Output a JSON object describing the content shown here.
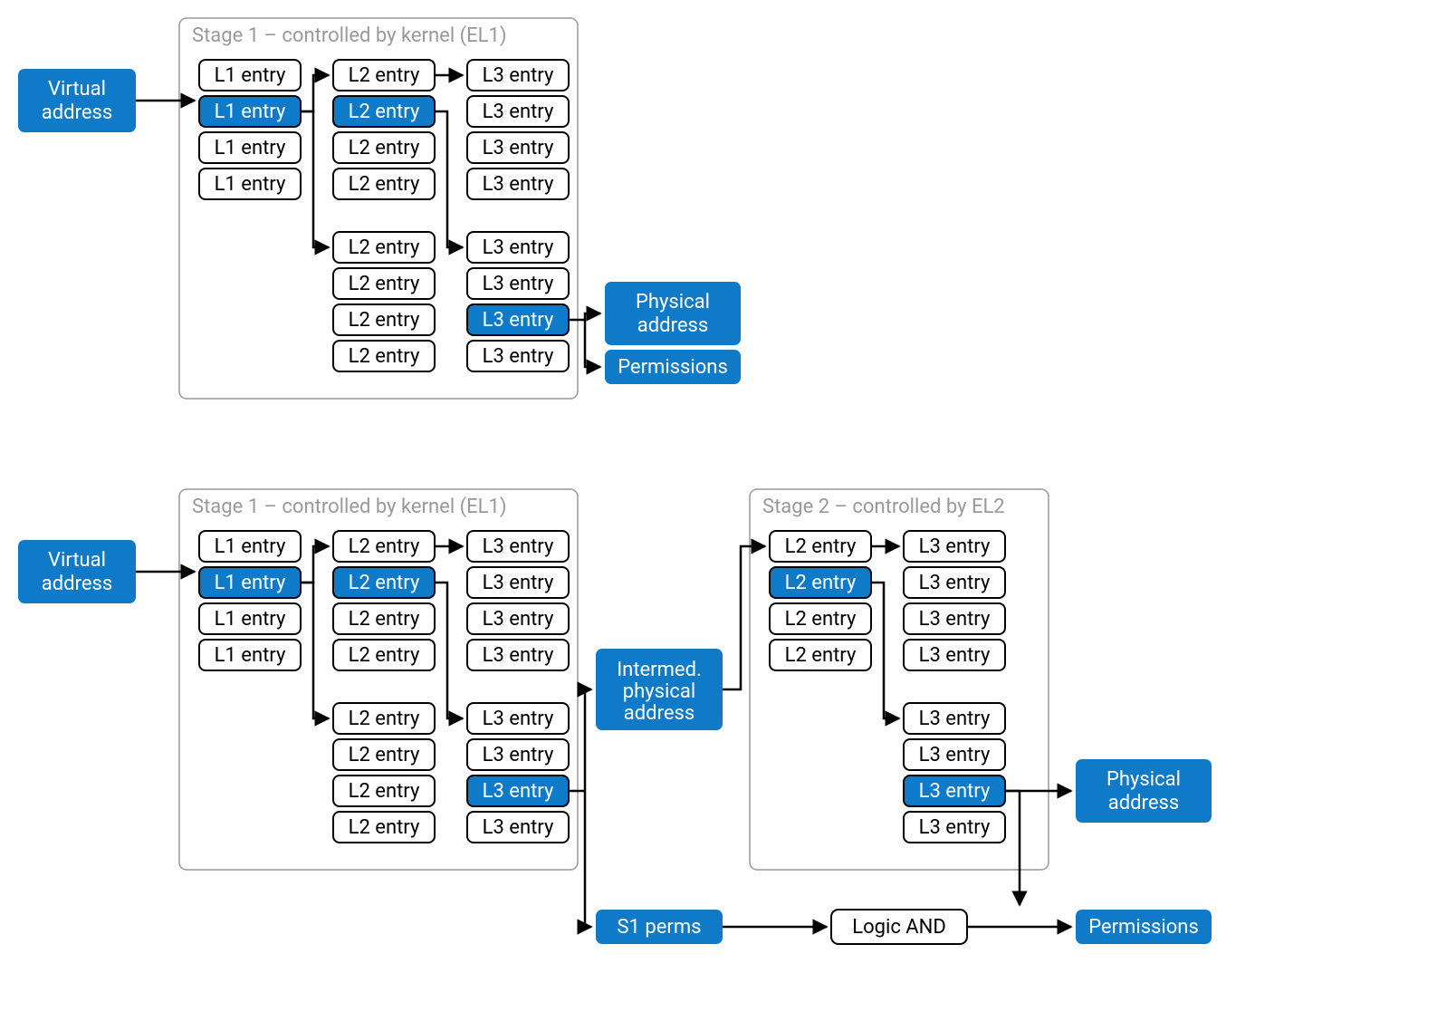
{
  "labels": {
    "virtual_address": "Virtual address",
    "physical_address": "Physical address",
    "permissions": "Permissions",
    "intermed_physical_address": "Intermed. physical address",
    "s1_perms": "S1 perms",
    "logic_and": "Logic AND",
    "stage1_title": "Stage 1 – controlled by kernel (EL1)",
    "stage2_title": "Stage 2 – controlled by EL2",
    "l1_entry": "L1 entry",
    "l2_entry": "L2 entry",
    "l3_entry": "L3 entry"
  },
  "diagram_top": {
    "stage1": {
      "l1": [
        {
          "label_key": "l1_entry",
          "highlighted": false
        },
        {
          "label_key": "l1_entry",
          "highlighted": true
        },
        {
          "label_key": "l1_entry",
          "highlighted": false
        },
        {
          "label_key": "l1_entry",
          "highlighted": false
        }
      ],
      "l2_top": [
        {
          "label_key": "l2_entry",
          "highlighted": false
        },
        {
          "label_key": "l2_entry",
          "highlighted": true
        },
        {
          "label_key": "l2_entry",
          "highlighted": false
        },
        {
          "label_key": "l2_entry",
          "highlighted": false
        }
      ],
      "l3_top": [
        {
          "label_key": "l3_entry",
          "highlighted": false
        },
        {
          "label_key": "l3_entry",
          "highlighted": false
        },
        {
          "label_key": "l3_entry",
          "highlighted": false
        },
        {
          "label_key": "l3_entry",
          "highlighted": false
        }
      ],
      "l2_bottom": [
        {
          "label_key": "l2_entry",
          "highlighted": false
        },
        {
          "label_key": "l2_entry",
          "highlighted": false
        },
        {
          "label_key": "l2_entry",
          "highlighted": false
        },
        {
          "label_key": "l2_entry",
          "highlighted": false
        }
      ],
      "l3_bottom": [
        {
          "label_key": "l3_entry",
          "highlighted": false
        },
        {
          "label_key": "l3_entry",
          "highlighted": false
        },
        {
          "label_key": "l3_entry",
          "highlighted": true
        },
        {
          "label_key": "l3_entry",
          "highlighted": false
        }
      ]
    },
    "outputs": [
      "physical_address",
      "permissions"
    ]
  },
  "diagram_bottom": {
    "stage1": {
      "l1": [
        {
          "label_key": "l1_entry",
          "highlighted": false
        },
        {
          "label_key": "l1_entry",
          "highlighted": true
        },
        {
          "label_key": "l1_entry",
          "highlighted": false
        },
        {
          "label_key": "l1_entry",
          "highlighted": false
        }
      ],
      "l2_top": [
        {
          "label_key": "l2_entry",
          "highlighted": false
        },
        {
          "label_key": "l2_entry",
          "highlighted": true
        },
        {
          "label_key": "l2_entry",
          "highlighted": false
        },
        {
          "label_key": "l2_entry",
          "highlighted": false
        }
      ],
      "l3_top": [
        {
          "label_key": "l3_entry",
          "highlighted": false
        },
        {
          "label_key": "l3_entry",
          "highlighted": false
        },
        {
          "label_key": "l3_entry",
          "highlighted": false
        },
        {
          "label_key": "l3_entry",
          "highlighted": false
        }
      ],
      "l2_bottom": [
        {
          "label_key": "l2_entry",
          "highlighted": false
        },
        {
          "label_key": "l2_entry",
          "highlighted": false
        },
        {
          "label_key": "l2_entry",
          "highlighted": false
        },
        {
          "label_key": "l2_entry",
          "highlighted": false
        }
      ],
      "l3_bottom": [
        {
          "label_key": "l3_entry",
          "highlighted": false
        },
        {
          "label_key": "l3_entry",
          "highlighted": false
        },
        {
          "label_key": "l3_entry",
          "highlighted": true
        },
        {
          "label_key": "l3_entry",
          "highlighted": false
        }
      ]
    },
    "stage2": {
      "l2": [
        {
          "label_key": "l2_entry",
          "highlighted": false
        },
        {
          "label_key": "l2_entry",
          "highlighted": true
        },
        {
          "label_key": "l2_entry",
          "highlighted": false
        },
        {
          "label_key": "l2_entry",
          "highlighted": false
        }
      ],
      "l3_top": [
        {
          "label_key": "l3_entry",
          "highlighted": false
        },
        {
          "label_key": "l3_entry",
          "highlighted": false
        },
        {
          "label_key": "l3_entry",
          "highlighted": false
        },
        {
          "label_key": "l3_entry",
          "highlighted": false
        }
      ],
      "l3_bottom": [
        {
          "label_key": "l3_entry",
          "highlighted": false
        },
        {
          "label_key": "l3_entry",
          "highlighted": false
        },
        {
          "label_key": "l3_entry",
          "highlighted": true
        },
        {
          "label_key": "l3_entry",
          "highlighted": false
        }
      ]
    },
    "outputs": [
      "intermed_physical_address",
      "s1_perms",
      "logic_and",
      "physical_address",
      "permissions"
    ]
  }
}
